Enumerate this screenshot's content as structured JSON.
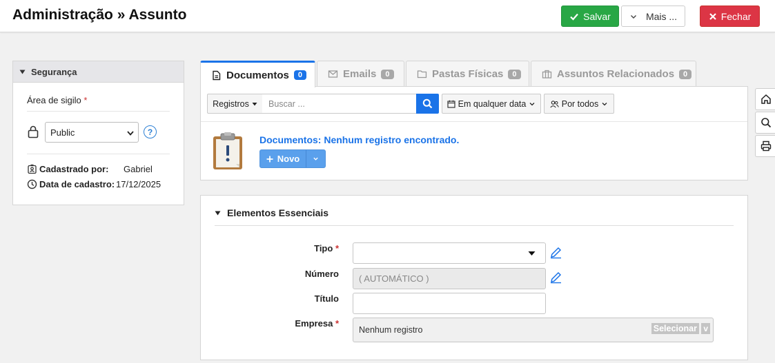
{
  "header": {
    "title": "Administração » Assunto",
    "save_label": "Salvar",
    "more_label": "Mais ...",
    "close_label": "Fechar"
  },
  "security": {
    "title": "Segurança",
    "field_label": "Área de sigilo",
    "required_mark": "*",
    "selected": "Public",
    "help": "?",
    "created_by_label": "Cadastrado por:",
    "created_by": "Gabriel",
    "created_at_label": "Data de cadastro:",
    "created_at": "17/12/2025"
  },
  "tabs": [
    {
      "label": "Documentos",
      "count": "0",
      "active": true
    },
    {
      "label": "Emails",
      "count": "0",
      "active": false
    },
    {
      "label": "Pastas Físicas",
      "count": "0",
      "active": false
    },
    {
      "label": "Assuntos Relacionados",
      "count": "0",
      "active": false
    }
  ],
  "documents": {
    "records_label": "Registros",
    "search_placeholder": "Buscar ...",
    "date_filter": "Em qualquer data",
    "user_filter": "Por todos",
    "empty_message": "Documentos: Nenhum registro encontrado.",
    "new_label": "Novo"
  },
  "essentials": {
    "title": "Elementos Essenciais",
    "tipo_label": "Tipo",
    "numero_label": "Número",
    "numero_value": "( AUTOMÁTICO )",
    "titulo_label": "Título",
    "empresa_label": "Empresa",
    "empresa_value": "Nenhum registro",
    "select_label": "Selecionar",
    "select_toggle": "v",
    "required_mark": "*"
  },
  "colors": {
    "primary": "#1a73e8",
    "success": "#28a745",
    "danger": "#dc3545"
  }
}
